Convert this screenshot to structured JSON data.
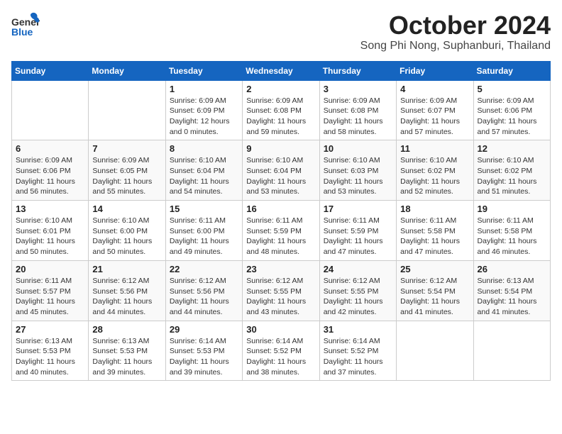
{
  "header": {
    "logo_general": "General",
    "logo_blue": "Blue",
    "title": "October 2024",
    "subtitle": "Song Phi Nong, Suphanburi, Thailand"
  },
  "weekdays": [
    "Sunday",
    "Monday",
    "Tuesday",
    "Wednesday",
    "Thursday",
    "Friday",
    "Saturday"
  ],
  "weeks": [
    [
      {
        "day": "",
        "info": ""
      },
      {
        "day": "",
        "info": ""
      },
      {
        "day": "1",
        "info": "Sunrise: 6:09 AM\nSunset: 6:09 PM\nDaylight: 12 hours\nand 0 minutes."
      },
      {
        "day": "2",
        "info": "Sunrise: 6:09 AM\nSunset: 6:08 PM\nDaylight: 11 hours\nand 59 minutes."
      },
      {
        "day": "3",
        "info": "Sunrise: 6:09 AM\nSunset: 6:08 PM\nDaylight: 11 hours\nand 58 minutes."
      },
      {
        "day": "4",
        "info": "Sunrise: 6:09 AM\nSunset: 6:07 PM\nDaylight: 11 hours\nand 57 minutes."
      },
      {
        "day": "5",
        "info": "Sunrise: 6:09 AM\nSunset: 6:06 PM\nDaylight: 11 hours\nand 57 minutes."
      }
    ],
    [
      {
        "day": "6",
        "info": "Sunrise: 6:09 AM\nSunset: 6:06 PM\nDaylight: 11 hours\nand 56 minutes."
      },
      {
        "day": "7",
        "info": "Sunrise: 6:09 AM\nSunset: 6:05 PM\nDaylight: 11 hours\nand 55 minutes."
      },
      {
        "day": "8",
        "info": "Sunrise: 6:10 AM\nSunset: 6:04 PM\nDaylight: 11 hours\nand 54 minutes."
      },
      {
        "day": "9",
        "info": "Sunrise: 6:10 AM\nSunset: 6:04 PM\nDaylight: 11 hours\nand 53 minutes."
      },
      {
        "day": "10",
        "info": "Sunrise: 6:10 AM\nSunset: 6:03 PM\nDaylight: 11 hours\nand 53 minutes."
      },
      {
        "day": "11",
        "info": "Sunrise: 6:10 AM\nSunset: 6:02 PM\nDaylight: 11 hours\nand 52 minutes."
      },
      {
        "day": "12",
        "info": "Sunrise: 6:10 AM\nSunset: 6:02 PM\nDaylight: 11 hours\nand 51 minutes."
      }
    ],
    [
      {
        "day": "13",
        "info": "Sunrise: 6:10 AM\nSunset: 6:01 PM\nDaylight: 11 hours\nand 50 minutes."
      },
      {
        "day": "14",
        "info": "Sunrise: 6:10 AM\nSunset: 6:00 PM\nDaylight: 11 hours\nand 50 minutes."
      },
      {
        "day": "15",
        "info": "Sunrise: 6:11 AM\nSunset: 6:00 PM\nDaylight: 11 hours\nand 49 minutes."
      },
      {
        "day": "16",
        "info": "Sunrise: 6:11 AM\nSunset: 5:59 PM\nDaylight: 11 hours\nand 48 minutes."
      },
      {
        "day": "17",
        "info": "Sunrise: 6:11 AM\nSunset: 5:59 PM\nDaylight: 11 hours\nand 47 minutes."
      },
      {
        "day": "18",
        "info": "Sunrise: 6:11 AM\nSunset: 5:58 PM\nDaylight: 11 hours\nand 47 minutes."
      },
      {
        "day": "19",
        "info": "Sunrise: 6:11 AM\nSunset: 5:58 PM\nDaylight: 11 hours\nand 46 minutes."
      }
    ],
    [
      {
        "day": "20",
        "info": "Sunrise: 6:11 AM\nSunset: 5:57 PM\nDaylight: 11 hours\nand 45 minutes."
      },
      {
        "day": "21",
        "info": "Sunrise: 6:12 AM\nSunset: 5:56 PM\nDaylight: 11 hours\nand 44 minutes."
      },
      {
        "day": "22",
        "info": "Sunrise: 6:12 AM\nSunset: 5:56 PM\nDaylight: 11 hours\nand 44 minutes."
      },
      {
        "day": "23",
        "info": "Sunrise: 6:12 AM\nSunset: 5:55 PM\nDaylight: 11 hours\nand 43 minutes."
      },
      {
        "day": "24",
        "info": "Sunrise: 6:12 AM\nSunset: 5:55 PM\nDaylight: 11 hours\nand 42 minutes."
      },
      {
        "day": "25",
        "info": "Sunrise: 6:12 AM\nSunset: 5:54 PM\nDaylight: 11 hours\nand 41 minutes."
      },
      {
        "day": "26",
        "info": "Sunrise: 6:13 AM\nSunset: 5:54 PM\nDaylight: 11 hours\nand 41 minutes."
      }
    ],
    [
      {
        "day": "27",
        "info": "Sunrise: 6:13 AM\nSunset: 5:53 PM\nDaylight: 11 hours\nand 40 minutes."
      },
      {
        "day": "28",
        "info": "Sunrise: 6:13 AM\nSunset: 5:53 PM\nDaylight: 11 hours\nand 39 minutes."
      },
      {
        "day": "29",
        "info": "Sunrise: 6:14 AM\nSunset: 5:53 PM\nDaylight: 11 hours\nand 39 minutes."
      },
      {
        "day": "30",
        "info": "Sunrise: 6:14 AM\nSunset: 5:52 PM\nDaylight: 11 hours\nand 38 minutes."
      },
      {
        "day": "31",
        "info": "Sunrise: 6:14 AM\nSunset: 5:52 PM\nDaylight: 11 hours\nand 37 minutes."
      },
      {
        "day": "",
        "info": ""
      },
      {
        "day": "",
        "info": ""
      }
    ]
  ]
}
